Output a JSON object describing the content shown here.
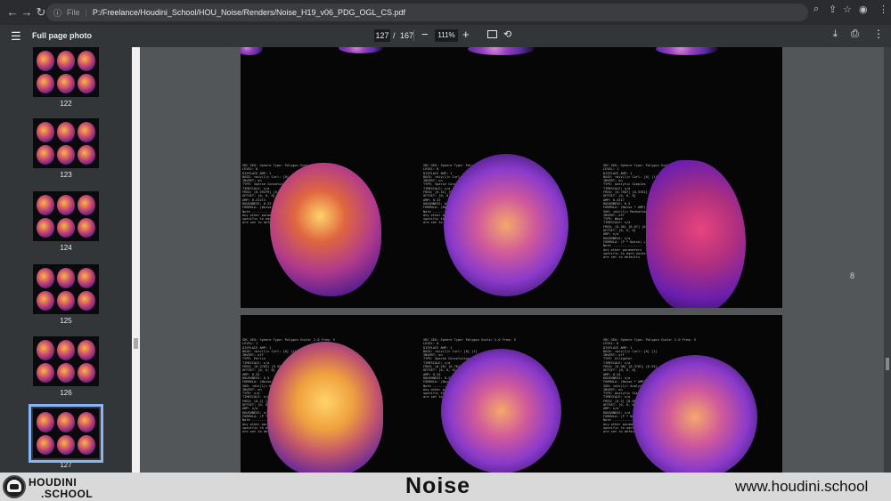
{
  "browser": {
    "back": "←",
    "forward": "→",
    "reload": "↻",
    "scheme": "File",
    "url": "P:/Freelance/Houdini_School/HOU_Noise/Renders/Noise_H19_v06_PDG_OGL_CS.pdf"
  },
  "pdf_toolbar": {
    "title": "Full page photo",
    "current_page": "127",
    "separator": "/",
    "total_pages": "167",
    "zoom": "111%",
    "zoom_out": "−",
    "zoom_in": "+"
  },
  "thumbnails": [
    {
      "page": ""
    },
    {
      "page": "122"
    },
    {
      "page": "123"
    },
    {
      "page": "124"
    },
    {
      "page": "125"
    },
    {
      "page": "126"
    },
    {
      "page": "127"
    }
  ],
  "pages": {
    "upper": {
      "columns": [
        {
          "lines": [
            "SRC GEO: Sphere Type: Polygon Scale: 2.0 Freq: 5",
            "LEVEL: 0",
            "DISPLACE AMP: 1",
            "BASE: <div(1)> Curl: [0] [1]",
            "     INVERT: on",
            "     TYPE: Sparse Convolution",
            "     TIMESCALE: n/a",
            "     FREQ: [0.39379] [0.8765] [0.27591] ...",
            "     OFFSET: [0, 0, 0]",
            "     AMP: 0.25213",
            "     ROUGHNESS: 0.25",
            "     FORMULA: (Noise * AMP) + Displace Along Normal [anti]",
            "Note ---------------",
            "Any other parameters",
            "specific to each noise node",
            "are set to defaults"
          ]
        },
        {
          "lines": [
            "SRC GEO: Sphere Type: Polygon Scale: 2.0 Freq: 5",
            "LEVEL: 0",
            "DISPLACE AMP: 1",
            "BASE: <div(1)> Curl: [0] [1]",
            "     INVERT: on",
            "     TYPE: Sparse Convolution",
            "     TIMESCALE: n/a",
            "     FREQ: [0.31] [0.875] [0.263] ...",
            "     OFFSET: [0, 0, 0]",
            "     AMP: 0.32",
            "     ROUGHNESS: 0.25",
            "     FORMULA: (Noise * AMP) + Displace Along Normal [anti]",
            "Note ---------------",
            "Any other parameters",
            "specific to each noise node",
            "are set to defaults"
          ]
        },
        {
          "lines": [
            "SRC GEO: Sphere Type: Polygon Scale: 2.0 Freq: 5",
            "LEVEL: 1",
            "DISPLACE AMP: 1",
            "BASE: <div(1)> Curl: [0] [1]",
            "     INVERT: on",
            "     TYPE: Analytic Simplex",
            "     TIMESCALE: n/a",
            "     FREQ: [0.7587] [0.5762] [0.64] ...",
            "     OFFSET: [0, 0, 0]",
            "     AMP: 0.4317",
            "     ROUGHNESS: 0.5",
            "     FORMULA: (Noise * AMP) + Displace Along Normal [anti]",
            "SUB: <div(1)> Manhattan Chebyshev F4",
            "     INVERT: off",
            "     TYPE: Wave",
            "     TIMESCALE: n/a",
            "     FREQ: [0.36] [0.87] [0.38] ...",
            "     OFFSET: [0, 0, 0]",
            "     AMP: n/a",
            "     ROUGHNESS: n/a",
            "     FORMULA: (P * Noise) + Displace Along Normal [anti]",
            "Note ---------------",
            "Any other parameters",
            "specific to each noise node",
            "are set to defaults"
          ]
        }
      ]
    },
    "lower": {
      "columns": [
        {
          "lines": [
            "SRC GEO: Sphere Type: Polygon Scale: 2.0 Freq: 5",
            "LEVEL: 1",
            "DISPLACE AMP: 1",
            "BASE: <div(1)> Curl: [0] [1]",
            "     INVERT: off",
            "     TYPE: Perlin",
            "     TIMESCALE: n/a",
            "     FREQ: [0.2783] [0.5947] [0.51] ...",
            "     OFFSET: [0, 0, 0]",
            "     AMP: 0.32",
            "     ROUGHNESS: 0.5",
            "     FORMULA: (Noise * AMP) + Displace Along Normal [anti]",
            "SUB: <div(1)> Worley Cellular F1",
            "     INVERT: on",
            "     TYPE: n/a",
            "     TIMESCALE: n/a",
            "     FREQ: [0.2] [0.89] [0.56] ...",
            "     OFFSET: [0, 0, 0]",
            "     AMP: n/a",
            "     ROUGHNESS: n/a",
            "     FORMULA: (P * Noise) + Displace Along Normal [anti]",
            "Note ---------------",
            "Any other parameters",
            "specific to each noise node",
            "are set to defaults"
          ]
        },
        {
          "lines": [
            "SRC GEO: Sphere Type: Polygon Scale: 2.0 Freq: 5",
            "LEVEL: 0",
            "DISPLACE AMP: 1",
            "BASE: <div(1)> Curl: [0] [1]",
            "     INVERT: on",
            "     TYPE: Sparse Convolution",
            "     TIMESCALE: n/a",
            "     FREQ: [0.28] [0.762] [0.53] ...",
            "     OFFSET: [0, 0, 0]",
            "     AMP: 0.34",
            "     ROUGHNESS: 0.25",
            "     FORMULA: (Noise * AMP) + Displace Along Normal [anti]",
            "Note ---------------",
            "Any other parameters",
            "specific to each noise node",
            "are set to defaults"
          ]
        },
        {
          "lines": [
            "SRC GEO: Sphere Type: Polygon Scale: 2.0 Freq: 5",
            "LEVEL: 0",
            "DISPLACE AMP: 1",
            "BASE: <div(1)> Curl: [0] [1]",
            "     INVERT: off",
            "     TYPE: Alligator",
            "     TIMESCALE: n/a",
            "     FREQ: [0.98] [0.3762] [0.53] ...",
            "     OFFSET: [0, 0, 0]",
            "     AMP: 0.24",
            "     ROUGHNESS: n/a",
            "     FORMULA: (Noise * AMP) + Displace Along Normal [anti]",
            "SUB: <div(1)> Analytic Simplex",
            "     INVERT: on",
            "     TYPE: Analytic Simplex",
            "     TIMESCALE: n/a",
            "     FREQ: [0.2] [0.88] [0.23] ...",
            "     OFFSET: [0, 0, 0]",
            "     AMP: n/a",
            "     ROUGHNESS: n/a",
            "     FORMULA: (P * Noise) + Displace Along Normal [anti]",
            "Note ---------------",
            "Any other parameters",
            "specific to each noise node",
            "are set to defaults"
          ]
        }
      ]
    }
  },
  "overlay_page_marker": "8",
  "banner": {
    "brand_line1": "HOUDINI",
    "brand_line2": ".SCHOOL",
    "topic": "Noise",
    "website": "www.houdini.school"
  },
  "colors": {
    "accent_selection": "#8ab4f8",
    "render_warm": "#ffb347",
    "render_mid": "#c2456f",
    "render_cool": "#5a1a8a"
  }
}
